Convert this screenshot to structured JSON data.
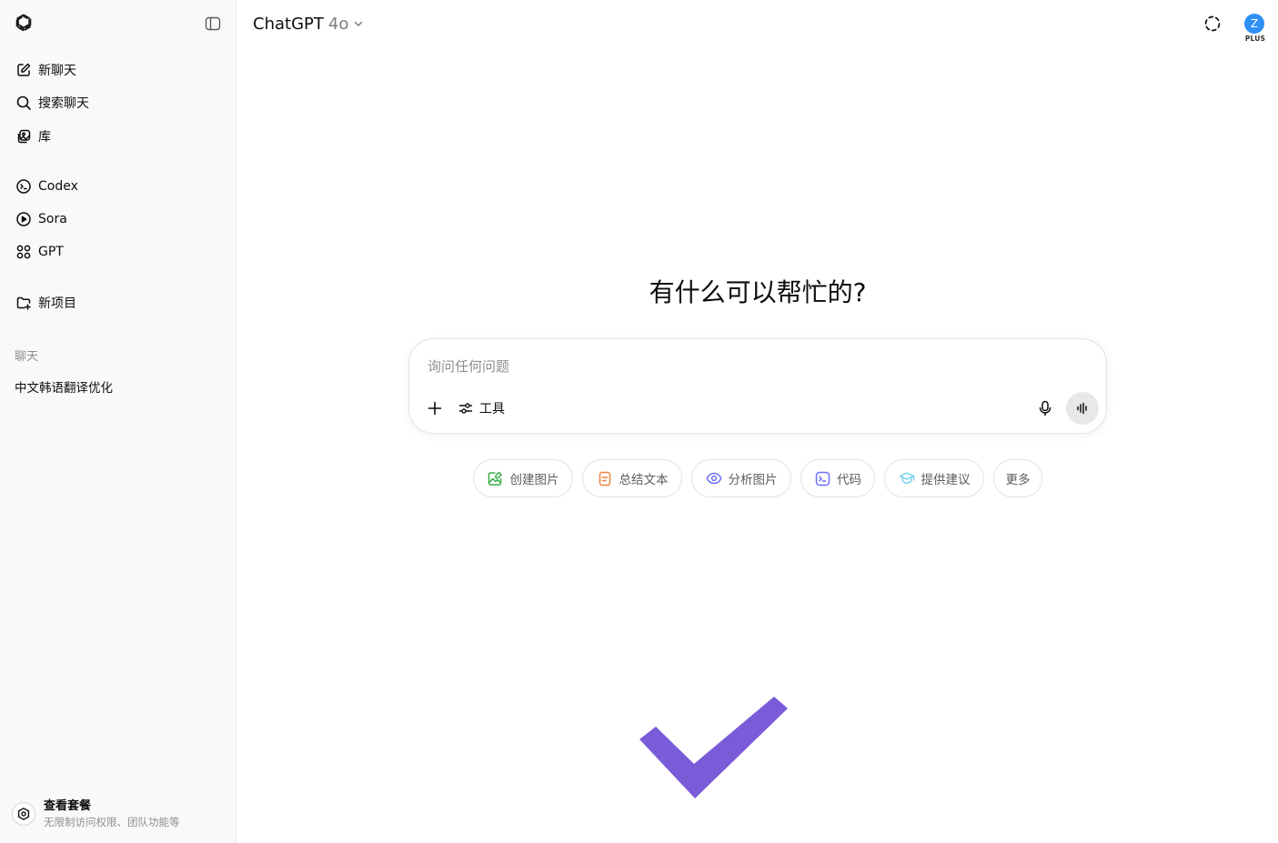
{
  "sidebar": {
    "nav": [
      {
        "label": "新聊天"
      },
      {
        "label": "搜索聊天"
      },
      {
        "label": "库"
      }
    ],
    "apps": [
      {
        "label": "Codex"
      },
      {
        "label": "Sora"
      },
      {
        "label": "GPT"
      }
    ],
    "new_project": "新项目",
    "section_title": "聊天",
    "chats": [
      "中文韩语翻译优化"
    ],
    "plan": {
      "title": "查看套餐",
      "subtitle": "无限制访问权限、团队功能等"
    }
  },
  "header": {
    "model_name": "ChatGPT",
    "model_version": "4o",
    "avatar_initial": "Z",
    "plan_badge": "PLUS"
  },
  "main": {
    "headline": "有什么可以帮忙的?",
    "composer": {
      "placeholder": "询问任何问题",
      "value": "",
      "tools_label": "工具"
    },
    "suggestions": [
      {
        "label": "创建图片",
        "icon": "image-edit-icon",
        "color": "#35ae47"
      },
      {
        "label": "总结文本",
        "icon": "document-icon",
        "color": "#ea8444"
      },
      {
        "label": "分析图片",
        "icon": "eye-icon",
        "color": "#6c71ff"
      },
      {
        "label": "代码",
        "icon": "terminal-icon",
        "color": "#6c71ff"
      },
      {
        "label": "提供建议",
        "icon": "graduation-cap-icon",
        "color": "#76d0eb"
      },
      {
        "label": "更多",
        "icon": "",
        "color": "#5d5d5d"
      }
    ]
  },
  "colors": {
    "sidebar_bg": "#f9f9f9",
    "avatar_bg": "#2f8ff5",
    "checkmark": "#7a5cd9"
  }
}
